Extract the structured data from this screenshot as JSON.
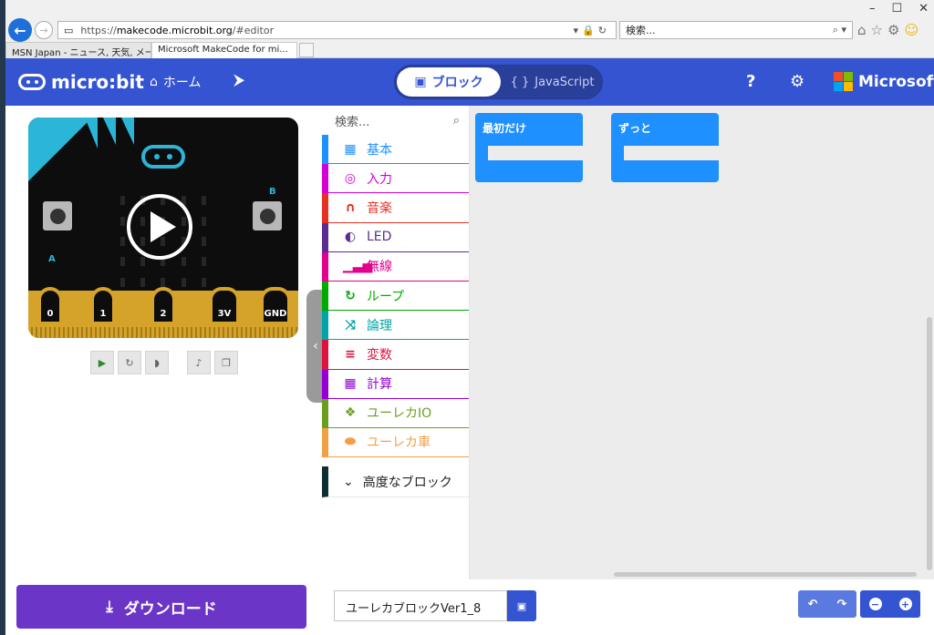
{
  "browser": {
    "url_prefix": "https://",
    "url_host": "makecode.microbit.org",
    "url_path": "/#editor",
    "search_placeholder": "検索...",
    "tabs": [
      {
        "label": "MSN Japan - ニュース, 天気, メー..."
      },
      {
        "label": "Microsoft MakeCode for mi..."
      }
    ]
  },
  "header": {
    "logo_text": "micro:bit",
    "home_label": "ホーム",
    "toggle_blocks": "ブロック",
    "toggle_js": "JavaScript",
    "brand": "Microsoft",
    "colors": {
      "header": "#3454d1",
      "accent": "#1e90ff",
      "download": "#6b35c8"
    }
  },
  "simulator": {
    "button_a": "A",
    "button_b": "B",
    "pins": [
      "0",
      "1",
      "2",
      "3V",
      "GND"
    ],
    "controls": [
      "play-icon",
      "restart-icon",
      "slow-mo-icon",
      "sound-icon",
      "fullscreen-icon"
    ]
  },
  "toolbox": {
    "search_placeholder": "検索...",
    "categories": [
      {
        "label": "基本",
        "color": "#1e90ff",
        "icon": "grid-icon"
      },
      {
        "label": "入力",
        "color": "#d400d4",
        "icon": "target-icon"
      },
      {
        "label": "音楽",
        "color": "#e63022",
        "icon": "headphones-icon"
      },
      {
        "label": "LED",
        "color": "#5c2d91",
        "icon": "toggle-icon"
      },
      {
        "label": "無線",
        "color": "#e3008c",
        "icon": "signal-icon"
      },
      {
        "label": "ループ",
        "color": "#00aa00",
        "icon": "refresh-icon"
      },
      {
        "label": "論理",
        "color": "#00a4a6",
        "icon": "shuffle-icon"
      },
      {
        "label": "変数",
        "color": "#dc143c",
        "icon": "list-icon"
      },
      {
        "label": "計算",
        "color": "#9400d3",
        "icon": "calculator-icon"
      },
      {
        "label": "ユーレカIO",
        "color": "#6b9e1f",
        "icon": "puzzle-icon"
      },
      {
        "label": "ユーレカ車",
        "color": "#f2a045",
        "icon": "car-icon"
      }
    ],
    "advanced_label": "高度なブロック",
    "advanced_color": "#0e2f32"
  },
  "workspace": {
    "blocks": [
      {
        "label": "最初だけ"
      },
      {
        "label": "ずっと"
      }
    ]
  },
  "footer": {
    "download_label": "ダウンロード",
    "project_name": "ユーレカブロックVer1_8"
  }
}
